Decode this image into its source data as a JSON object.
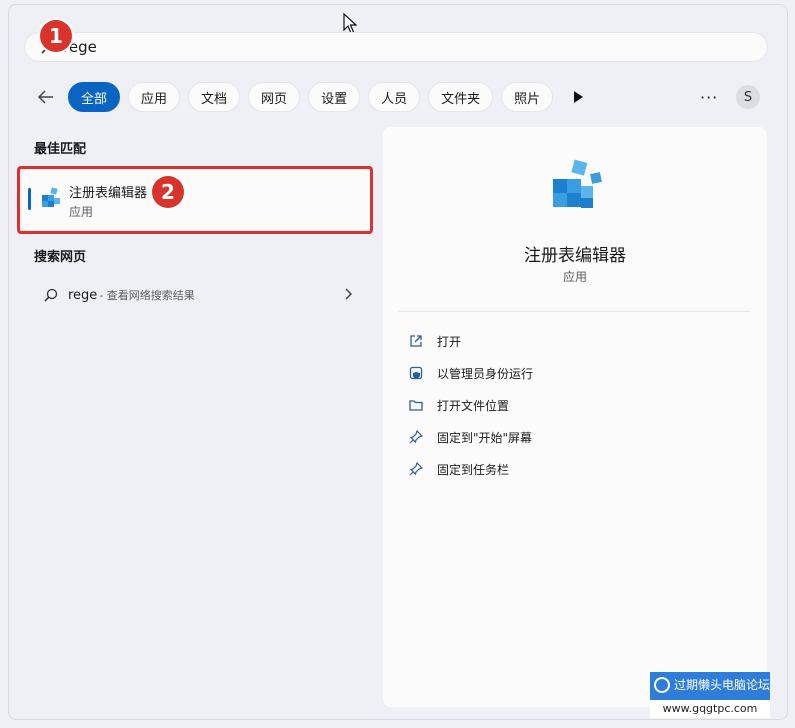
{
  "search": {
    "query": "rege"
  },
  "annotations": {
    "step1": "1",
    "step2": "2"
  },
  "filters": {
    "items": [
      "全部",
      "应用",
      "文档",
      "网页",
      "设置",
      "人员",
      "文件夹",
      "照片"
    ],
    "active_index": 0,
    "more_label": "···",
    "avatar_letter": "S"
  },
  "left": {
    "best_match_title": "最佳匹配",
    "best_match": {
      "name": "注册表编辑器",
      "type": "应用"
    },
    "web_section_title": "搜索网页",
    "web_result": {
      "term": "rege",
      "desc": "- 查看网络搜索结果"
    }
  },
  "right": {
    "app_name": "注册表编辑器",
    "app_type": "应用",
    "actions": [
      {
        "icon": "open-icon",
        "label": "打开"
      },
      {
        "icon": "admin-shield-icon",
        "label": "以管理员身份运行"
      },
      {
        "icon": "folder-icon",
        "label": "打开文件位置"
      },
      {
        "icon": "pin-icon",
        "label": "固定到\"开始\"屏幕"
      },
      {
        "icon": "pin-icon",
        "label": "固定到任务栏"
      }
    ]
  },
  "watermark": {
    "title": "过期懒头电脑论坛",
    "url": "www.gqgtpc.com"
  },
  "colors": {
    "accent": "#0a64c2",
    "annotation_red": "#d9342b"
  }
}
